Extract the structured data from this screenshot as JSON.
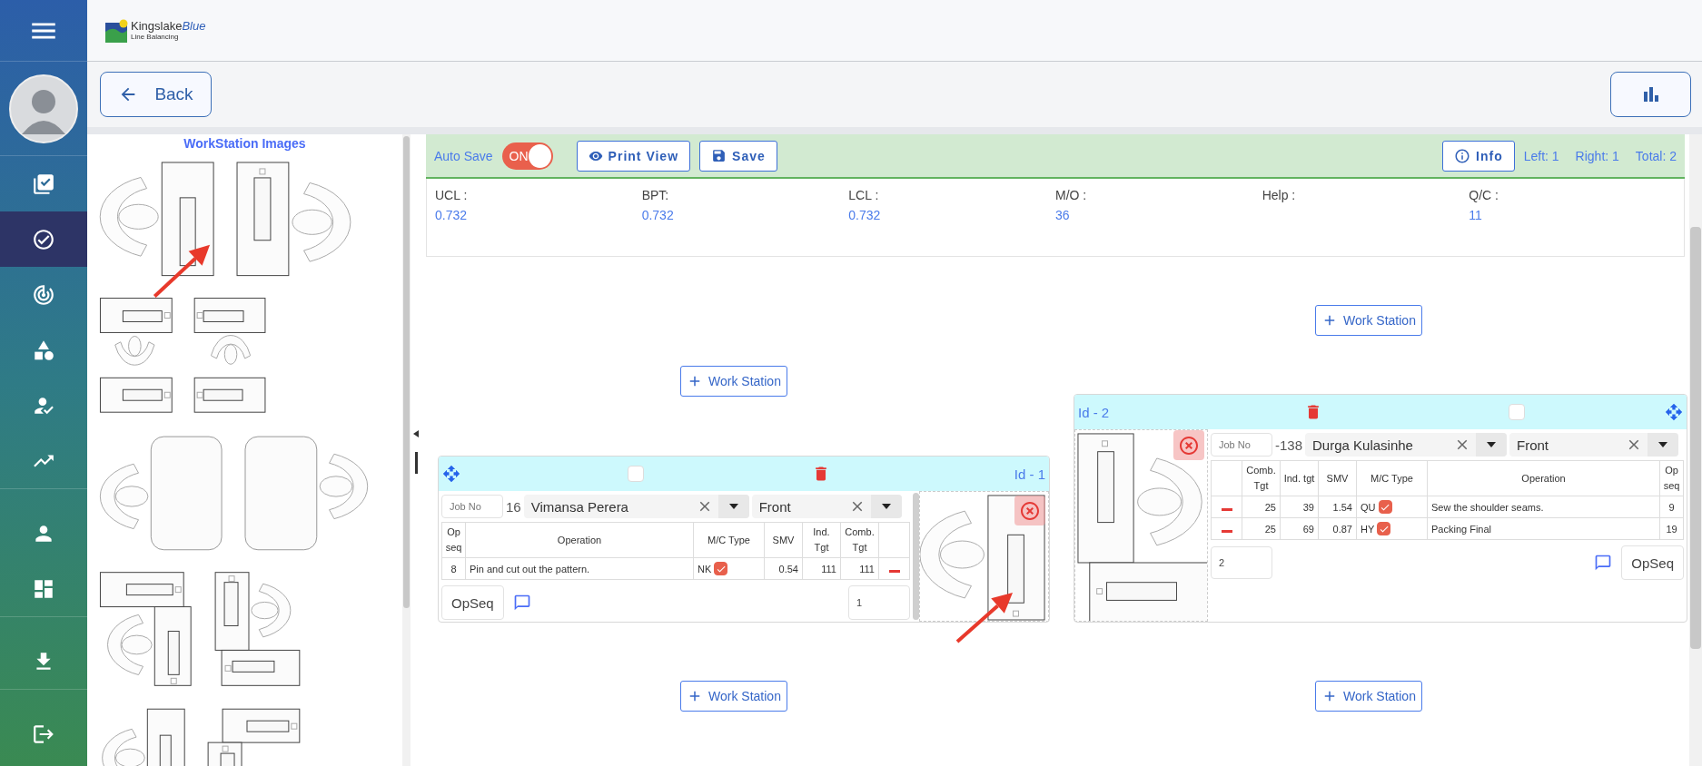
{
  "brand": {
    "name": "Kingslake",
    "accent": "Blue",
    "subtitle": "Line Balancing"
  },
  "nav_groups": [
    [
      {
        "selected": false
      },
      {
        "selected": true
      },
      {
        "selected": false
      },
      {
        "selected": false
      },
      {
        "selected": false
      },
      {
        "selected": false
      }
    ],
    [
      {
        "selected": false
      },
      {
        "selected": false
      }
    ],
    [
      {
        "selected": false
      }
    ],
    [
      {
        "selected": false
      }
    ]
  ],
  "back_button": "Back",
  "side_panel": {
    "title": "WorkStation Images"
  },
  "toolbar": {
    "auto_save": {
      "label": "Auto Save",
      "toggle_text": "ON",
      "on": true
    },
    "print_view_button": "Print View",
    "save_button": "Save",
    "info_button": "Info",
    "counts": [
      "Left: 1",
      "Right: 1",
      "Total: 2"
    ]
  },
  "metrics": [
    {
      "label": "UCL :",
      "value": "0.732"
    },
    {
      "label": "BPT:",
      "value": "0.732"
    },
    {
      "label": "LCL :",
      "value": "0.732"
    },
    {
      "label": "M/O :",
      "value": "36"
    },
    {
      "label": "Help :"
    },
    {
      "label": "Q/C :",
      "value": "11"
    }
  ],
  "add_station_buttons": [
    "Work Station",
    "Work Station",
    "Work Station",
    "Work Station"
  ],
  "workstations": [
    {
      "kind": "table-first",
      "id": "Id - 1",
      "checked": false,
      "job_placeholder": "Job No",
      "job_value": "16",
      "operator": "Vimansa Perera",
      "position": "Front",
      "columns": [
        {
          "kind": "seq",
          "label": "Op seq"
        },
        {
          "kind": "operation",
          "label": "Operation"
        },
        {
          "kind": "machine",
          "label": "M/C Type"
        },
        {
          "kind": "number",
          "label": "SMV"
        },
        {
          "kind": "number",
          "label": "Ind. Tgt"
        },
        {
          "kind": "number",
          "label": "Comb. Tgt"
        }
      ],
      "rows": [
        {
          "cells": [
            "8",
            "Pin and cut out the pattern.",
            "NK",
            "0.54",
            "111",
            "111"
          ],
          "mc_checked": true
        }
      ],
      "count": "1",
      "opseq_button": "OpSeq"
    },
    {
      "kind": "image-first",
      "id": "Id - 2",
      "checked": false,
      "job_placeholder": "Job No",
      "job_value": "-138",
      "operator": "Durga Kulasinhe",
      "position": "Front",
      "columns": [
        {
          "kind": "number",
          "label": "Comb. Tgt"
        },
        {
          "kind": "number",
          "label": "Ind. tgt"
        },
        {
          "kind": "number",
          "label": "SMV"
        },
        {
          "kind": "machine",
          "label": "M/C Type"
        },
        {
          "kind": "operation",
          "label": "Operation"
        },
        {
          "kind": "seq",
          "label": "Op seq"
        }
      ],
      "rows": [
        {
          "cells": [
            "25",
            "39",
            "1.54",
            "QU",
            "Sew the shoulder seams.",
            "9"
          ],
          "mc_checked": true
        },
        {
          "cells": [
            "25",
            "69",
            "0.87",
            "HY",
            "Packing Final",
            "19"
          ],
          "mc_checked": true
        }
      ],
      "count": "2",
      "opseq_button": "OpSeq"
    }
  ]
}
